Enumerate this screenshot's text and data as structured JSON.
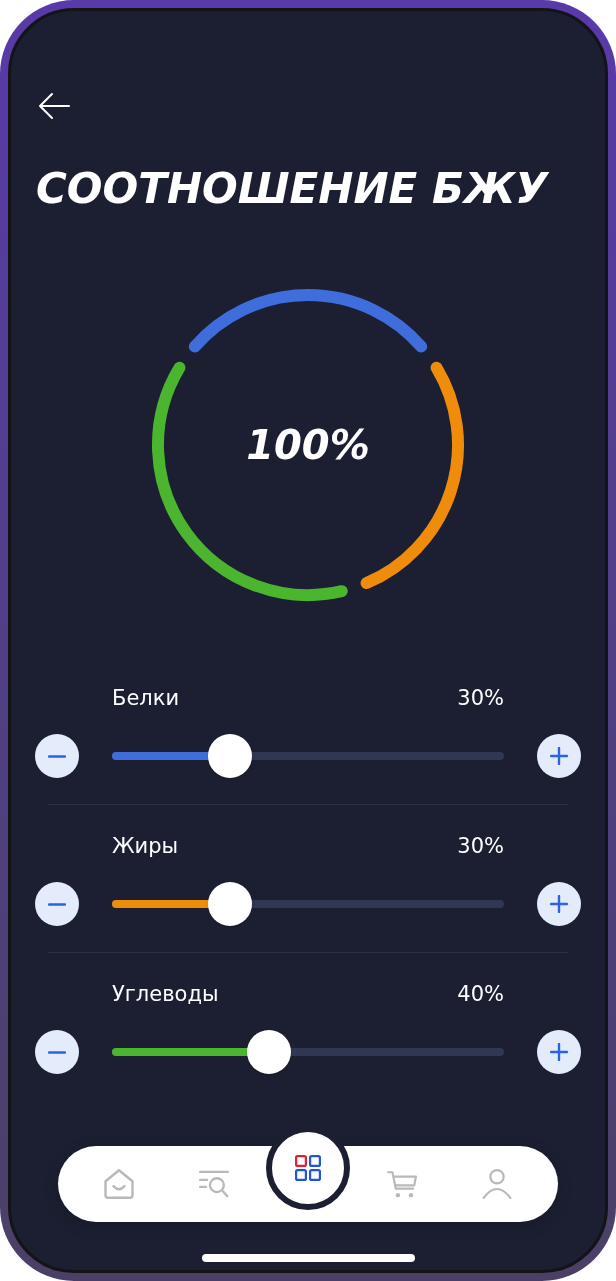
{
  "header": {
    "title": "СООТНОШЕНИЕ БЖУ"
  },
  "donut": {
    "center_label": "100%"
  },
  "macros": [
    {
      "name": "Белки",
      "reading": "30%",
      "level": 0.3,
      "color": "#3f6ddc"
    },
    {
      "name": "Жиры",
      "reading": "30%",
      "level": 0.3,
      "color": "#f08c0c"
    },
    {
      "name": "Углеводы",
      "reading": "40%",
      "level": 0.4,
      "color": "#4cb52f"
    }
  ],
  "nav": {
    "items": [
      {
        "selected": false
      },
      {
        "selected": false
      },
      {
        "selected": true
      },
      {
        "selected": false
      },
      {
        "selected": false
      }
    ]
  }
}
